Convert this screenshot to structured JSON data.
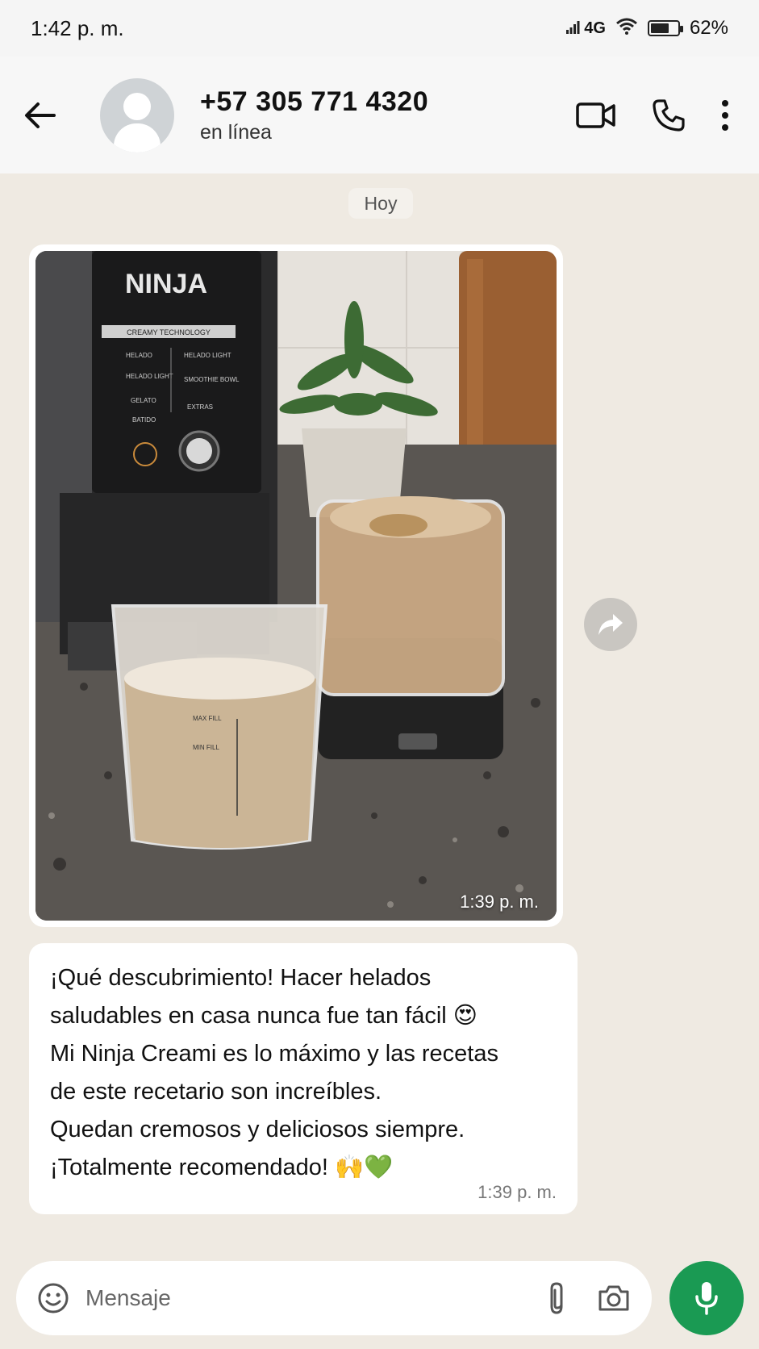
{
  "status_bar": {
    "time": "1:42 p. m.",
    "network": "4G",
    "battery": "62%"
  },
  "header": {
    "contact_name": "+57 305 771 4320",
    "contact_status": "en línea"
  },
  "chat": {
    "date_label": "Hoy",
    "image_message": {
      "time": "1:39 p. m.",
      "photo_labels": {
        "brand": "NINJA",
        "panel_title": "CREAMY TECHNOLOGY",
        "programs_left": [
          "HELADO",
          "HELADO LIGHT",
          "GELATO",
          "BATIDO"
        ],
        "programs_right": [
          "HELADO LIGHT",
          "SMOOTHIE BOWL",
          "EXTRAS"
        ],
        "cup_fill_lines": [
          "MAX FILL",
          "MIN FILL"
        ]
      }
    },
    "text_message": {
      "lines": [
        "¡Qué descubrimiento! Hacer helados",
        "saludables en casa nunca fue tan fácil 😍",
        "Mi Ninja Creami es lo máximo y las recetas",
        "de este recetario son increíbles.",
        "Quedan cremosos y deliciosos siempre.",
        "¡Totalmente recomendado! 🙌💚"
      ],
      "time": "1:39 p. m."
    }
  },
  "composer": {
    "placeholder": "Mensaje"
  },
  "colors": {
    "chat_background": "#efeae2",
    "mic_button": "#1a9a53",
    "bubble": "#ffffff"
  }
}
